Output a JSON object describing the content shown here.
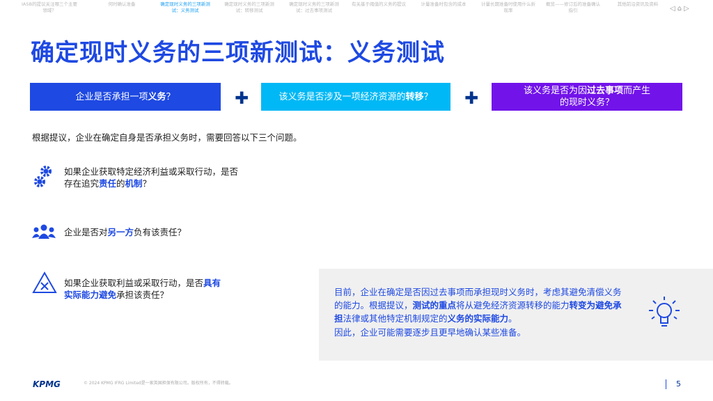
{
  "nav": {
    "items": [
      "IASB的提议关注哪三个主要领域？",
      "何时确认准备",
      "确定现时义务的三项新测试：义务测试",
      "确定现时义务的三项新测试：转移测试",
      "确定现时义务的三项新测试：过去事项测试",
      "有关基于阈值的义务的提议",
      "计量准备时包含的成本",
      "计量长期准备时使用什么折现率",
      "概览——修订后的准备确认指引",
      "其他前沿资讯及资料"
    ],
    "active_index": 2
  },
  "title": "确定现时义务的三项新测试：义务测试",
  "boxes": [
    {
      "pre": "企业是否承担一项",
      "bold": "义务",
      "post": "？"
    },
    {
      "pre": "该义务是否涉及一项经济资源的",
      "bold": "转移",
      "post": "？"
    },
    {
      "pre": "该义务是否为因",
      "bold": "过去事项",
      "post": "而产生的现时义务？"
    }
  ],
  "plus": "✚",
  "intro": "根据提议，企业在确定自身是否承担义务时，需要回答以下三个问题。",
  "questions": [
    {
      "a": "如果企业获取特定经济利益或采取行动，是否存在追究",
      "b": "责任",
      "c": "的",
      "d": "机制",
      "e": "？"
    },
    {
      "a": "企业是否对",
      "b": "另一方",
      "c": "负有该责任？"
    },
    {
      "a": "如果企业获取利益或采取行动，是否",
      "b": "具有实际能力避免",
      "c": "承担该责任？"
    }
  ],
  "panel": {
    "p1a": "目前，企业在确定是否因过去事项而承担现时义务时，考虑其避免清偿义务的能力。根据提议，",
    "p1b": "测试的重点",
    "p1c": "将从避免经济资源转移的能力",
    "p1d": "转变为避免承担",
    "p1e": "法律或其他特定机制规定的",
    "p1f": "义务的实际能力",
    "p1g": "。",
    "p2": "因此，企业可能需要逐步且更早地确认某些准备。"
  },
  "footer": {
    "logo": "KPMG",
    "copyright": "© 2024 KPMG IFRG Limited是一家英国担保有限公司。版权所有，不得转载。",
    "page": "5"
  },
  "colors": {
    "blue": "#1E49E2",
    "cyan": "#00B8F5",
    "purple": "#7213EA",
    "navy": "#00338D"
  }
}
